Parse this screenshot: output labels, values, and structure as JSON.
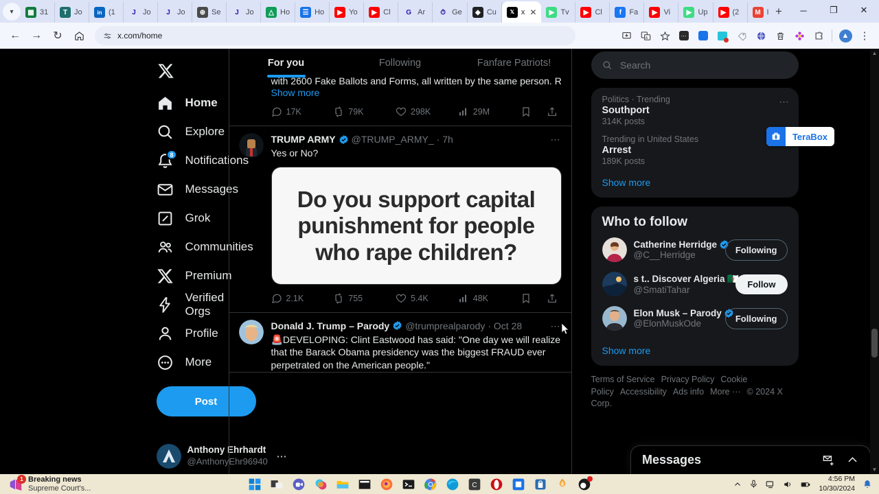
{
  "browser": {
    "url": "x.com/home",
    "tabs": [
      {
        "label": "31",
        "icon": "grid-green-icon",
        "color": "#0f7b3d",
        "glyph": "▦"
      },
      {
        "label": "Jo",
        "icon": "teams-icon",
        "color": "#1f6f6f",
        "glyph": "T"
      },
      {
        "label": "(1",
        "icon": "linkedin-icon",
        "color": "#0a66c2",
        "glyph": "in"
      },
      {
        "label": "Jo",
        "icon": "joblogic-icon",
        "color": "#ffffff",
        "glyph": "J"
      },
      {
        "label": "Jo",
        "icon": "joblogic-icon",
        "color": "#ffffff",
        "glyph": "J"
      },
      {
        "label": "Se",
        "icon": "globe-icon",
        "color": "#4a4a4a",
        "glyph": "⊕"
      },
      {
        "label": "Jo",
        "icon": "joblogic-icon",
        "color": "#ffffff",
        "glyph": "J"
      },
      {
        "label": "Ho",
        "icon": "google-drive-icon",
        "color": "#0f9d58",
        "glyph": "△"
      },
      {
        "label": "Ho",
        "icon": "google-docs-icon",
        "color": "#1a73e8",
        "glyph": "☰"
      },
      {
        "label": "Yo",
        "icon": "youtube-icon",
        "color": "#ff0000",
        "glyph": "▶"
      },
      {
        "label": "Cl",
        "icon": "youtube-icon",
        "color": "#ff0000",
        "glyph": "▶"
      },
      {
        "label": "Ar",
        "icon": "google-icon",
        "color": "#ffffff",
        "glyph": "G"
      },
      {
        "label": "Ge",
        "icon": "stopwatch-icon",
        "color": "#ffffff",
        "glyph": "⏱"
      },
      {
        "label": "Cu",
        "icon": "dark-app-icon",
        "color": "#202124",
        "glyph": "◆"
      },
      {
        "label": "x",
        "icon": "x-icon",
        "color": "#000000",
        "glyph": "𝕏",
        "active": true
      },
      {
        "label": "Tv",
        "icon": "play-green-icon",
        "color": "#3ddc84",
        "glyph": "▶"
      },
      {
        "label": "Cl",
        "icon": "youtube-icon",
        "color": "#ff0000",
        "glyph": "▶"
      },
      {
        "label": "Fa",
        "icon": "facebook-icon",
        "color": "#1877f2",
        "glyph": "f"
      },
      {
        "label": "Vi",
        "icon": "youtube-icon",
        "color": "#ff0000",
        "glyph": "▶"
      },
      {
        "label": "Up",
        "icon": "play-green-icon",
        "color": "#3ddc84",
        "glyph": "▶"
      },
      {
        "label": "(2",
        "icon": "youtube-icon",
        "color": "#ff0000",
        "glyph": "▶"
      },
      {
        "label": "In",
        "icon": "gmail-icon",
        "color": "#ea4335",
        "glyph": "M"
      }
    ],
    "new_tab_label": "+",
    "window_controls": {
      "minimize": "─",
      "maximize": "❐",
      "close": "✕"
    },
    "nav": {
      "back": "←",
      "forward": "→",
      "reload": "↻",
      "home": "⌂",
      "site_settings": "⚙"
    },
    "toolbar_icons": [
      "install-icon",
      "translate-icon",
      "bookmark-star-icon",
      "extension-dark-icon",
      "extension-blue-icon",
      "extension-teal-icon",
      "extension-tag-icon",
      "extension-globe-icon",
      "extension-trash-icon",
      "extension-flower-icon",
      "extensions-puzzle-icon",
      "profile-avatar-icon",
      "chrome-menu-icon"
    ]
  },
  "sidebar": {
    "logo": "x-logo-icon",
    "items": [
      {
        "label": "Home",
        "icon": "home-icon",
        "active": true
      },
      {
        "label": "Explore",
        "icon": "search-icon",
        "active": false
      },
      {
        "label": "Notifications",
        "icon": "bell-icon",
        "active": false,
        "badge": "8"
      },
      {
        "label": "Messages",
        "icon": "envelope-icon",
        "active": false
      },
      {
        "label": "Grok",
        "icon": "grok-icon",
        "active": false
      },
      {
        "label": "Communities",
        "icon": "people-icon",
        "active": false
      },
      {
        "label": "Premium",
        "icon": "x-icon",
        "active": false
      },
      {
        "label": "Verified Orgs",
        "icon": "bolt-icon",
        "active": false
      },
      {
        "label": "Profile",
        "icon": "person-icon",
        "active": false
      },
      {
        "label": "More",
        "icon": "more-circle-icon",
        "active": false
      }
    ],
    "post_button": "Post",
    "account": {
      "name": "Anthony Ehrhardt",
      "handle": "@AnthonyEhr96940",
      "menu_icon": "ellipsis-icon"
    }
  },
  "feed": {
    "tabs": [
      {
        "label": "For you",
        "active": true
      },
      {
        "label": "Following",
        "active": false
      },
      {
        "label": "Fanfare Patriots!",
        "active": false
      }
    ],
    "partial_tweet": {
      "truncated_text": "with 2600 Fake Ballots and Forms, all written by the same person. Really",
      "show_more": "Show more",
      "actions": {
        "replies": "17K",
        "reposts": "79K",
        "likes": "298K",
        "views": "29M",
        "bookmark_icon": "bookmark-icon",
        "share_icon": "share-icon"
      }
    },
    "tweets": [
      {
        "name": "TRUMP ARMY",
        "verified": true,
        "handle": "@TRUMP_ARMY_",
        "time": "7h",
        "text": "Yes or No?",
        "media_text": "Do you support capital punishment for people who rape children?",
        "actions": {
          "replies": "2.1K",
          "reposts": "755",
          "likes": "5.4K",
          "views": "48K",
          "bookmark_icon": "bookmark-icon",
          "share_icon": "share-icon"
        }
      },
      {
        "name": "Donald J. Trump – Parody",
        "verified": true,
        "handle": "@trumprealparody",
        "time": "Oct 28",
        "text": "🚨DEVELOPING: Clint Eastwood has said: \"One day we will realize that the Barack Obama presidency was the biggest FRAUD ever perpetrated on the American people.\"",
        "media_text": "",
        "actions": {
          "replies": "",
          "reposts": "",
          "likes": "",
          "views": "",
          "bookmark_icon": "bookmark-icon",
          "share_icon": "share-icon"
        }
      }
    ]
  },
  "right": {
    "search": {
      "placeholder": "Search",
      "value": "",
      "icon": "search-icon"
    },
    "trends": [
      {
        "category": "Politics · Trending",
        "name": "Southport",
        "count": "314K posts"
      },
      {
        "category": "Trending in United States",
        "name": "Arrest",
        "count": "189K posts"
      }
    ],
    "trends_show_more": "Show more",
    "who_to_follow": {
      "title": "Who to follow",
      "people": [
        {
          "name": "Catherine Herridge",
          "verified": true,
          "handle": "@C__Herridge",
          "button": "Following",
          "button_style": "outline"
        },
        {
          "name": "s t.. Discover Algeria 🇩🇿",
          "verified": false,
          "handle": "@SmatiTahar",
          "button": "Follow",
          "button_style": "solid"
        },
        {
          "name": "Elon Musk – Parody",
          "verified": true,
          "handle": "@ElonMuskOde",
          "button": "Following",
          "button_style": "outline"
        }
      ],
      "show_more": "Show more"
    },
    "footer_links": [
      "Terms of Service",
      "Privacy Policy",
      "Cookie Policy",
      "Accessibility",
      "Ads info",
      "More ···",
      "© 2024 X Corp."
    ]
  },
  "overlays": {
    "terabox": {
      "label": "TeraBox",
      "icon": "terabox-icon"
    },
    "messages_dock": {
      "title": "Messages",
      "new_message_icon": "new-message-icon",
      "expand_icon": "chevron-up-icon"
    }
  },
  "taskbar": {
    "news": {
      "title": "Breaking news",
      "subtitle": "Supreme Court's...",
      "badge": "1"
    },
    "start_icon": "windows-start-icon",
    "apps": [
      {
        "name": "task-view-icon",
        "color": "#1b1b1b",
        "glyph": "◰"
      },
      {
        "name": "teams-icon",
        "color": "#5b5fc7",
        "glyph": "▢"
      },
      {
        "name": "copilot-icon",
        "color": "#d8d8d8",
        "glyph": "●"
      },
      {
        "name": "file-explorer-icon",
        "color": "#ffb900",
        "glyph": "▭"
      },
      {
        "name": "notepad-icon",
        "color": "#1b1b1b",
        "glyph": "▬"
      },
      {
        "name": "firefox-icon",
        "color": "#ff7139",
        "glyph": "●"
      },
      {
        "name": "terminal-icon",
        "color": "#1b1b1b",
        "glyph": ">_"
      },
      {
        "name": "chrome-icon",
        "color": "#4285f4",
        "glyph": "●",
        "running": true
      },
      {
        "name": "edge-icon",
        "color": "#0f9bd7",
        "glyph": "●"
      },
      {
        "name": "c-app-icon",
        "color": "#3a3a3a",
        "glyph": "C"
      },
      {
        "name": "opera-icon",
        "color": "#cc0f16",
        "glyph": "O"
      },
      {
        "name": "blue-app-icon",
        "color": "#1a73e8",
        "glyph": "■"
      },
      {
        "name": "microsoft-store-icon",
        "color": "#1a73e8",
        "glyph": "🛍"
      },
      {
        "name": "softphone-icon",
        "color": "#f0a030",
        "glyph": "◔"
      },
      {
        "name": "obs-icon",
        "color": "#1b1b1b",
        "glyph": "◉",
        "running": true,
        "badge": true
      }
    ],
    "system": {
      "overflow_icon": "chevron-up-icon",
      "mic_icon": "microphone-icon",
      "display_icon": "display-icon",
      "volume_icon": "volume-icon",
      "battery_icon": "battery-icon",
      "time": "4:56 PM",
      "date": "10/30/2024",
      "notification_icon": "bell-icon"
    }
  }
}
